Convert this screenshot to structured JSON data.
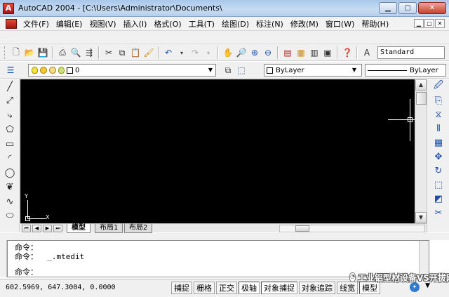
{
  "window": {
    "title": "AutoCAD 2004 - [C:\\Users\\Administrator\\Documents\\",
    "minimize": "▁",
    "maximize": "▢",
    "close": "✕"
  },
  "menu": {
    "items": [
      "文件(F)",
      "编辑(E)",
      "视图(V)",
      "插入(I)",
      "格式(O)",
      "工具(T)",
      "绘图(D)",
      "标注(N)",
      "修改(M)",
      "窗口(W)",
      "帮助(H)"
    ],
    "mdi": [
      "▁",
      "▢",
      "✕"
    ]
  },
  "toolbar": {
    "text_style": "Standard"
  },
  "layers": {
    "current_layer": "0",
    "color": "ByLayer",
    "linetype": "ByLayer"
  },
  "tabs": [
    "模型",
    "布局1",
    "布局2"
  ],
  "command": {
    "line1": "命令：",
    "line2": "命令：  _.mtedit",
    "prompt": "命令："
  },
  "status": {
    "coordinates": "602.5969, 647.3004, 0.0000",
    "toggles": [
      {
        "label": "捕捉",
        "on": false
      },
      {
        "label": "栅格",
        "on": false
      },
      {
        "label": "正交",
        "on": false
      },
      {
        "label": "极轴",
        "on": true
      },
      {
        "label": "对象捕捉",
        "on": true
      },
      {
        "label": "对象追踪",
        "on": false
      },
      {
        "label": "线宽",
        "on": false
      },
      {
        "label": "模型",
        "on": true
      }
    ]
  },
  "ucs": {
    "x": "X",
    "y": "Y"
  },
  "watermark": "工业铝型材设备VS开拔网"
}
